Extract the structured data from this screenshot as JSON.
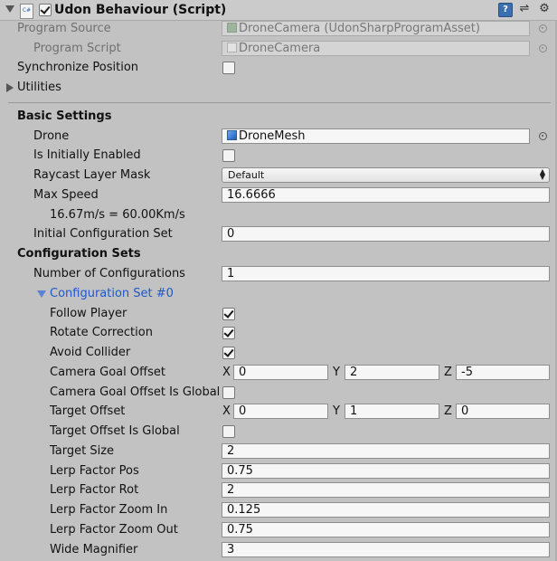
{
  "header": {
    "script_icon": "C#",
    "title": "Udon Behaviour (Script)",
    "enabled": true,
    "icons": [
      "help-book-icon",
      "presets-icon",
      "gear-icon"
    ]
  },
  "program": {
    "source_label": "Program Source",
    "source_value": "DroneCamera (UdonSharpProgramAsset)",
    "script_label": "Program Script",
    "script_value": "DroneCamera",
    "sync_label": "Synchronize Position",
    "sync_checked": false,
    "utilities_label": "Utilities"
  },
  "basic": {
    "section_label": "Basic Settings",
    "drone_label": "Drone",
    "drone_value": "DroneMesh",
    "initially_enabled_label": "Is Initially Enabled",
    "initially_enabled_checked": false,
    "raycast_label": "Raycast Layer Mask",
    "raycast_value": "Default",
    "max_speed_label": "Max Speed",
    "max_speed_value": "16.6666",
    "speed_note": "16.67m/s = 60.00Km/s",
    "initial_config_label": "Initial Configuration Set",
    "initial_config_value": "0"
  },
  "config": {
    "section_label": "Configuration Sets",
    "number_label": "Number of Configurations",
    "number_value": "1",
    "set_label": "Configuration Set #0",
    "follow_player_label": "Follow Player",
    "follow_player_checked": true,
    "rotate_correction_label": "Rotate Correction",
    "rotate_correction_checked": true,
    "avoid_collider_label": "Avoid Collider",
    "avoid_collider_checked": true,
    "goal_offset_label": "Camera Goal Offset",
    "goal_offset": {
      "x_label": "X",
      "x": "0",
      "y_label": "Y",
      "y": "2",
      "z_label": "Z",
      "z": "-5"
    },
    "goal_offset_global_label": "Camera Goal Offset Is Global",
    "goal_offset_global_checked": false,
    "target_offset_label": "Target Offset",
    "target_offset": {
      "x_label": "X",
      "x": "0",
      "y_label": "Y",
      "y": "1",
      "z_label": "Z",
      "z": "0"
    },
    "target_offset_global_label": "Target Offset Is Global",
    "target_offset_global_checked": false,
    "target_size_label": "Target Size",
    "target_size_value": "2",
    "lerp_pos_label": "Lerp Factor Pos",
    "lerp_pos_value": "0.75",
    "lerp_rot_label": "Lerp Factor Rot",
    "lerp_rot_value": "2",
    "lerp_zoom_in_label": "Lerp Factor Zoom In",
    "lerp_zoom_in_value": "0.125",
    "lerp_zoom_out_label": "Lerp Factor Zoom Out",
    "lerp_zoom_out_value": "0.75",
    "wide_magnifier_label": "Wide Magnifier",
    "wide_magnifier_value": "3"
  }
}
